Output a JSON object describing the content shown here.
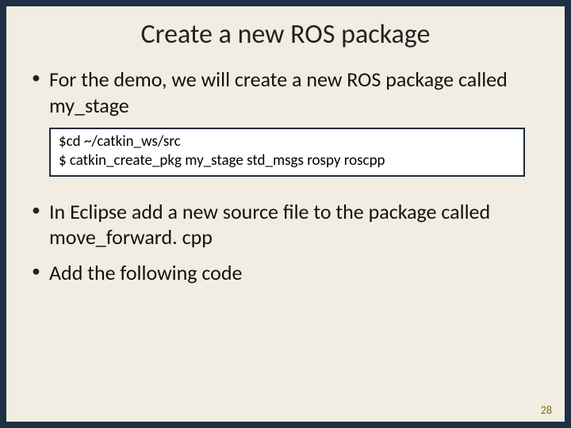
{
  "title": "Create a new ROS package",
  "bullets": {
    "b1": "For the demo, we will create a new ROS package called my_stage",
    "b2": "In Eclipse add a new source file to the package called move_forward. cpp",
    "b3": "Add the following code"
  },
  "code": {
    "line1": "$cd ~/catkin_ws/src",
    "line2": "$ catkin_create_pkg my_stage std_msgs rospy roscpp"
  },
  "page_number": "28"
}
